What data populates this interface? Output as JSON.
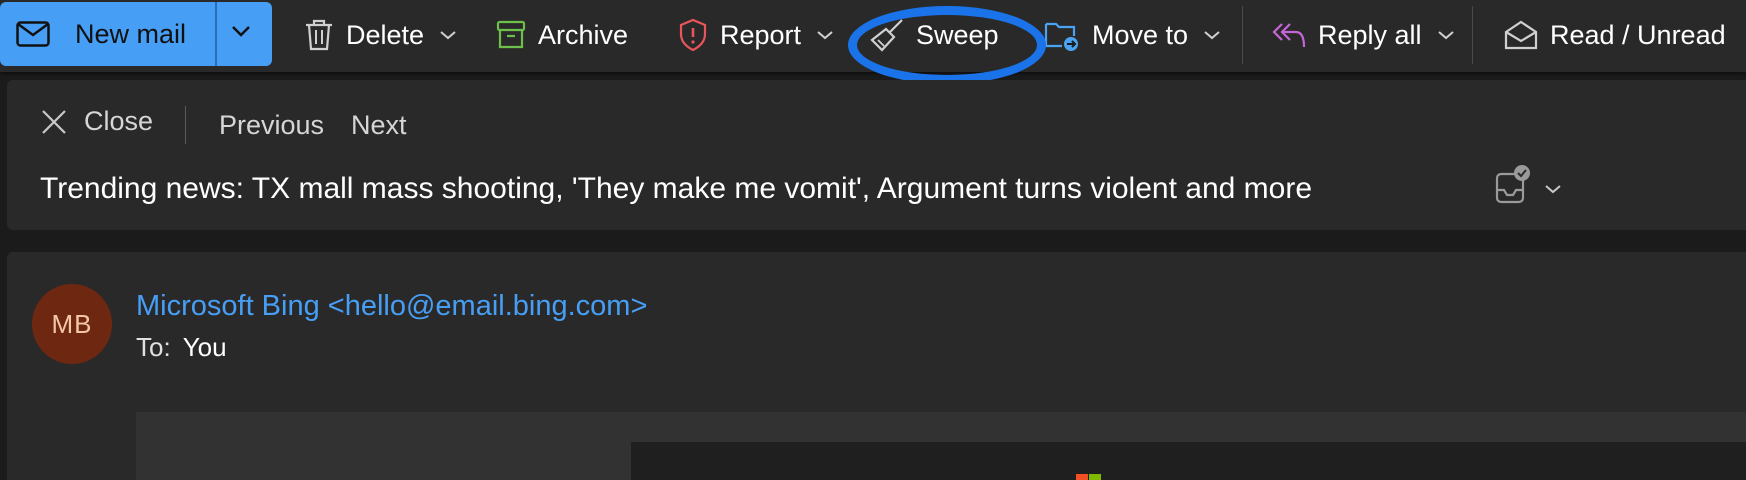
{
  "toolbar": {
    "new_mail": "New mail",
    "delete": "Delete",
    "archive": "Archive",
    "report": "Report",
    "sweep": "Sweep",
    "move_to": "Move to",
    "reply_all": "Reply all",
    "read_unread": "Read / Unread"
  },
  "header": {
    "close": "Close",
    "previous": "Previous",
    "next": "Next",
    "subject": "Trending news: TX mall mass shooting, 'They make me vomit', Argument turns violent and more"
  },
  "message": {
    "avatar_initials": "MB",
    "sender": "Microsoft Bing <hello@email.bing.com>",
    "to_label": "To:",
    "to_value": "You"
  },
  "colors": {
    "accent": "#479ef5",
    "highlight_ring": "#1a73e8",
    "archive_icon": "#6cc04a",
    "report_icon": "#e8555a",
    "reply_icon": "#c466d8",
    "avatar_bg": "#6e2812"
  },
  "icons": {
    "new_mail": "mail-icon",
    "delete": "trash-icon",
    "archive": "archive-icon",
    "report": "shield-alert-icon",
    "sweep": "broom-icon",
    "move_to": "folder-move-icon",
    "reply_all": "reply-all-icon",
    "read_unread": "envelope-open-icon"
  }
}
